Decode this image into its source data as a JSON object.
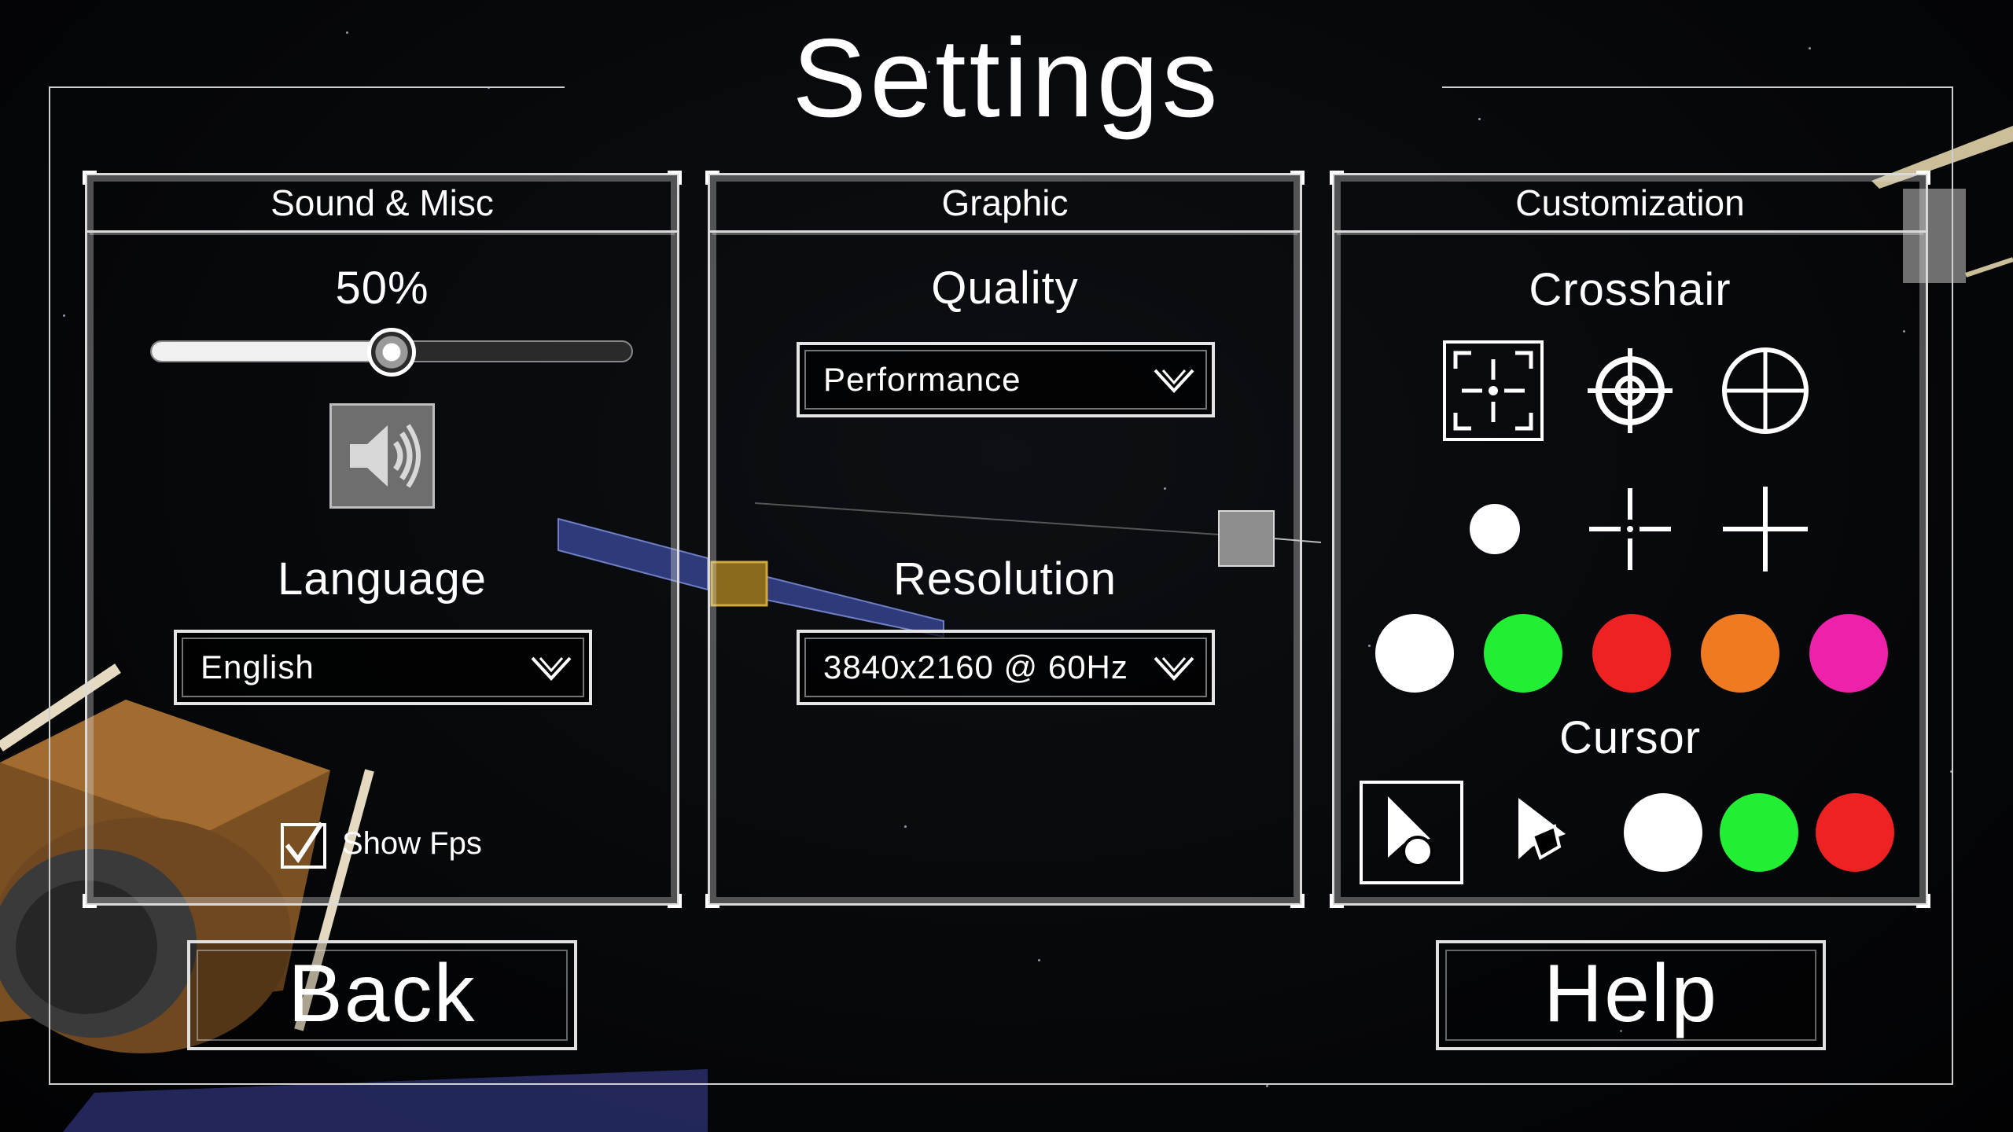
{
  "title": "Settings",
  "panels": {
    "sound": {
      "title": "Sound & Misc",
      "volume_label": "50%",
      "volume_fraction": 0.5,
      "language_label": "Language",
      "language_value": "English",
      "show_fps_label": "Show Fps",
      "show_fps_checked": true
    },
    "graphic": {
      "title": "Graphic",
      "quality_label": "Quality",
      "quality_value": "Performance",
      "resolution_label": "Resolution",
      "resolution_value": "3840x2160 @ 60Hz"
    },
    "custom": {
      "title": "Customization",
      "crosshair_label": "Crosshair",
      "crosshairs": [
        "bracket-crosshair-icon",
        "target-crosshair-icon",
        "circle-crosshair-icon",
        "dot-crosshair-icon",
        "gap-crosshair-icon",
        "plus-crosshair-icon"
      ],
      "crosshair_colors": [
        "#ffffff",
        "#22ee33",
        "#ee2222",
        "#f07a22",
        "#ee22aa"
      ],
      "cursor_label": "Cursor",
      "cursors": [
        "arrow-dot-cursor-icon",
        "arrow-diamond-cursor-icon"
      ],
      "cursor_colors": [
        "#ffffff",
        "#22ee33",
        "#ee2222"
      ]
    }
  },
  "buttons": {
    "back": "Back",
    "help": "Help"
  }
}
